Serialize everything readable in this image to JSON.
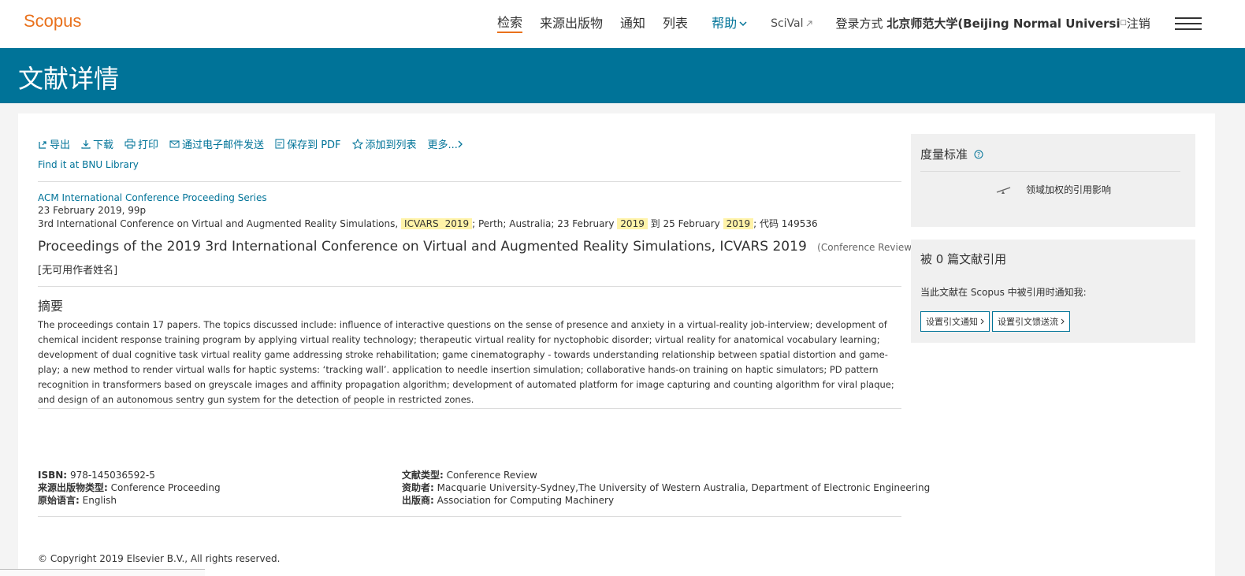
{
  "header": {
    "logo": "Scopus",
    "nav": {
      "search": "检索",
      "sources": "来源出版物",
      "alerts": "通知",
      "lists": "列表",
      "help": "帮助",
      "scival": "SciVal",
      "login_prefix": "登录方式",
      "institution": "北京师范大学(Beijing Normal Universi",
      "logout": "注销"
    }
  },
  "banner": {
    "title": "文献详情"
  },
  "toolbar": {
    "export": "导出",
    "download": "下载",
    "print": "打印",
    "email": "通过电子邮件发送",
    "save_pdf": "保存到 PDF",
    "add_list": "添加到列表",
    "more": "更多...",
    "find_it": "Find it at BNU Library"
  },
  "document": {
    "series": "ACM International Conference Proceeding Series",
    "date_pages": "23 February 2019, 99p",
    "conf_prefix": "3rd International Conference on Virtual and Augmented Reality Simulations,",
    "conf_acronym": "ICVARS",
    "conf_year": "2019",
    "conf_place": "; Perth; Australia; 23 February",
    "conf_year2": "2019",
    "conf_to": "到 25 February",
    "conf_year3": "2019",
    "conf_code": "; 代码 149536",
    "title": "Proceedings of the 2019 3rd International Conference on Virtual and Augmented Reality Simulations, ICVARS 2019",
    "doc_type_tag": "(Conference Review)",
    "authors": "[无可用作者姓名]"
  },
  "abstract": {
    "heading": "摘要",
    "text": "The proceedings contain 17 papers. The topics discussed include: influence of interactive questions on the sense of presence and anxiety in a virtual-reality job-interview; development of chemical incident response training program by applying virtual reality technology; therapeutic virtual reality for nyctophobic disorder; virtual reality for anatomical vocabulary learning; development of dual cognitive task virtual reality game addressing stroke rehabilitation; game cinematography - towards understanding relationship between spatial distortion and game-play; a new method to render virtual walls for haptic systems: ‘tracking wall’. application to needle insertion simulation; collaborative hands-on training on haptic simulators; PD pattern recognition in transformers based on greyscale images and affinity propagation algorithm; development of automated platform for image capturing and counting algorithm for viral plaque; and design of an autonomous sentry gun system for the detection of people in restricted zones."
  },
  "meta": {
    "isbn_label": "ISBN:",
    "isbn": "978-145036592-5",
    "source_type_label": "来源出版物类型:",
    "source_type": "Conference Proceeding",
    "language_label": "原始语言:",
    "language": "English",
    "doc_type_label": "文献类型:",
    "doc_type": "Conference Review",
    "sponsors_label": "资助者:",
    "sponsors": "Macquarie University-Sydney,The University of Western Australia, Department of Electronic Engineering",
    "publisher_label": "出版商:",
    "publisher": "Association for Computing Machinery"
  },
  "copyright": "© Copyright 2019 Elsevier B.V., All rights reserved.",
  "sidebar": {
    "metrics_title": "度量标准",
    "fwci": "领域加权的引用影响",
    "cited_by": "被 0 篇文献引用",
    "notify_text": "当此文献在 Scopus 中被引用时通知我:",
    "set_alert": "设置引文通知",
    "set_feed": "设置引文馈送流"
  },
  "colors": {
    "brand_orange": "#e9711c",
    "brand_teal": "#007398",
    "highlight": "#fff3a8"
  }
}
